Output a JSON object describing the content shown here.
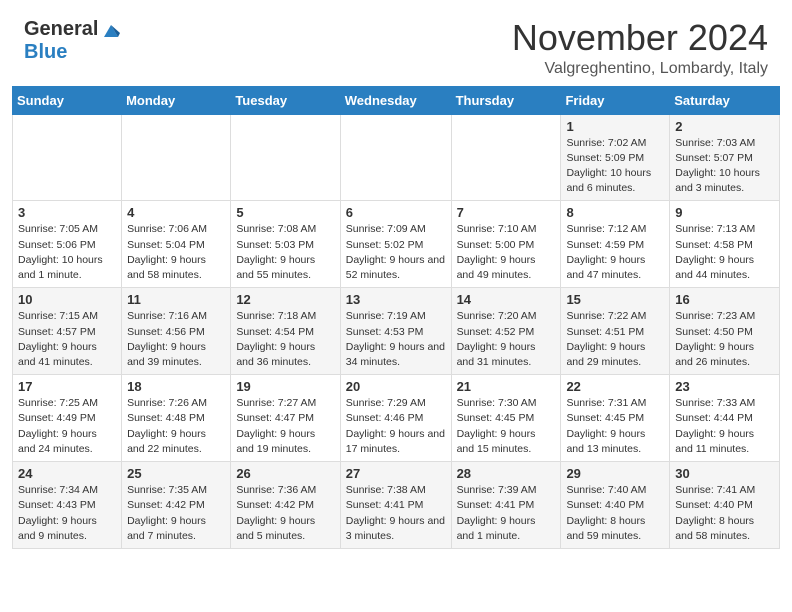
{
  "logo": {
    "general": "General",
    "blue": "Blue"
  },
  "title": {
    "month": "November 2024",
    "location": "Valgreghentino, Lombardy, Italy"
  },
  "days_of_week": [
    "Sunday",
    "Monday",
    "Tuesday",
    "Wednesday",
    "Thursday",
    "Friday",
    "Saturday"
  ],
  "weeks": [
    [
      {
        "day": "",
        "info": ""
      },
      {
        "day": "",
        "info": ""
      },
      {
        "day": "",
        "info": ""
      },
      {
        "day": "",
        "info": ""
      },
      {
        "day": "",
        "info": ""
      },
      {
        "day": "1",
        "info": "Sunrise: 7:02 AM\nSunset: 5:09 PM\nDaylight: 10 hours and 6 minutes."
      },
      {
        "day": "2",
        "info": "Sunrise: 7:03 AM\nSunset: 5:07 PM\nDaylight: 10 hours and 3 minutes."
      }
    ],
    [
      {
        "day": "3",
        "info": "Sunrise: 7:05 AM\nSunset: 5:06 PM\nDaylight: 10 hours and 1 minute."
      },
      {
        "day": "4",
        "info": "Sunrise: 7:06 AM\nSunset: 5:04 PM\nDaylight: 9 hours and 58 minutes."
      },
      {
        "day": "5",
        "info": "Sunrise: 7:08 AM\nSunset: 5:03 PM\nDaylight: 9 hours and 55 minutes."
      },
      {
        "day": "6",
        "info": "Sunrise: 7:09 AM\nSunset: 5:02 PM\nDaylight: 9 hours and 52 minutes."
      },
      {
        "day": "7",
        "info": "Sunrise: 7:10 AM\nSunset: 5:00 PM\nDaylight: 9 hours and 49 minutes."
      },
      {
        "day": "8",
        "info": "Sunrise: 7:12 AM\nSunset: 4:59 PM\nDaylight: 9 hours and 47 minutes."
      },
      {
        "day": "9",
        "info": "Sunrise: 7:13 AM\nSunset: 4:58 PM\nDaylight: 9 hours and 44 minutes."
      }
    ],
    [
      {
        "day": "10",
        "info": "Sunrise: 7:15 AM\nSunset: 4:57 PM\nDaylight: 9 hours and 41 minutes."
      },
      {
        "day": "11",
        "info": "Sunrise: 7:16 AM\nSunset: 4:56 PM\nDaylight: 9 hours and 39 minutes."
      },
      {
        "day": "12",
        "info": "Sunrise: 7:18 AM\nSunset: 4:54 PM\nDaylight: 9 hours and 36 minutes."
      },
      {
        "day": "13",
        "info": "Sunrise: 7:19 AM\nSunset: 4:53 PM\nDaylight: 9 hours and 34 minutes."
      },
      {
        "day": "14",
        "info": "Sunrise: 7:20 AM\nSunset: 4:52 PM\nDaylight: 9 hours and 31 minutes."
      },
      {
        "day": "15",
        "info": "Sunrise: 7:22 AM\nSunset: 4:51 PM\nDaylight: 9 hours and 29 minutes."
      },
      {
        "day": "16",
        "info": "Sunrise: 7:23 AM\nSunset: 4:50 PM\nDaylight: 9 hours and 26 minutes."
      }
    ],
    [
      {
        "day": "17",
        "info": "Sunrise: 7:25 AM\nSunset: 4:49 PM\nDaylight: 9 hours and 24 minutes."
      },
      {
        "day": "18",
        "info": "Sunrise: 7:26 AM\nSunset: 4:48 PM\nDaylight: 9 hours and 22 minutes."
      },
      {
        "day": "19",
        "info": "Sunrise: 7:27 AM\nSunset: 4:47 PM\nDaylight: 9 hours and 19 minutes."
      },
      {
        "day": "20",
        "info": "Sunrise: 7:29 AM\nSunset: 4:46 PM\nDaylight: 9 hours and 17 minutes."
      },
      {
        "day": "21",
        "info": "Sunrise: 7:30 AM\nSunset: 4:45 PM\nDaylight: 9 hours and 15 minutes."
      },
      {
        "day": "22",
        "info": "Sunrise: 7:31 AM\nSunset: 4:45 PM\nDaylight: 9 hours and 13 minutes."
      },
      {
        "day": "23",
        "info": "Sunrise: 7:33 AM\nSunset: 4:44 PM\nDaylight: 9 hours and 11 minutes."
      }
    ],
    [
      {
        "day": "24",
        "info": "Sunrise: 7:34 AM\nSunset: 4:43 PM\nDaylight: 9 hours and 9 minutes."
      },
      {
        "day": "25",
        "info": "Sunrise: 7:35 AM\nSunset: 4:42 PM\nDaylight: 9 hours and 7 minutes."
      },
      {
        "day": "26",
        "info": "Sunrise: 7:36 AM\nSunset: 4:42 PM\nDaylight: 9 hours and 5 minutes."
      },
      {
        "day": "27",
        "info": "Sunrise: 7:38 AM\nSunset: 4:41 PM\nDaylight: 9 hours and 3 minutes."
      },
      {
        "day": "28",
        "info": "Sunrise: 7:39 AM\nSunset: 4:41 PM\nDaylight: 9 hours and 1 minute."
      },
      {
        "day": "29",
        "info": "Sunrise: 7:40 AM\nSunset: 4:40 PM\nDaylight: 8 hours and 59 minutes."
      },
      {
        "day": "30",
        "info": "Sunrise: 7:41 AM\nSunset: 4:40 PM\nDaylight: 8 hours and 58 minutes."
      }
    ]
  ]
}
